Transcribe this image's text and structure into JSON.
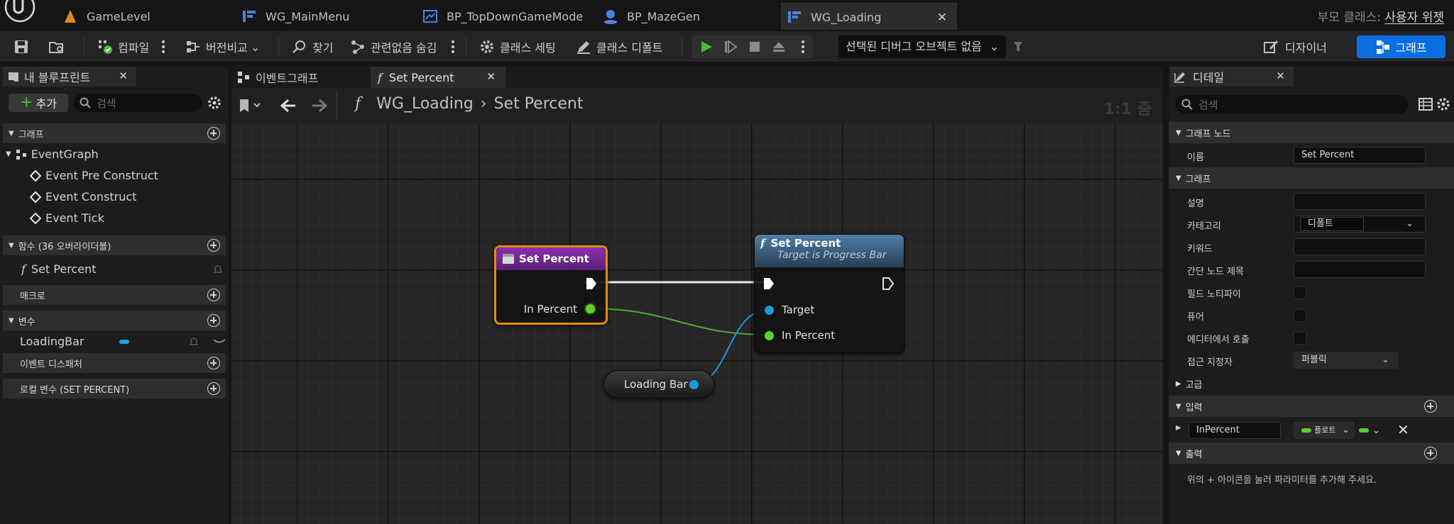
{
  "title_bar": {
    "tabs": [
      {
        "label": "GameLevel",
        "icon": "level-icon"
      },
      {
        "label": "WG_MainMenu",
        "icon": "widget-blueprint-icon"
      },
      {
        "label": "BP_TopDownGameMode",
        "icon": "blueprint-icon"
      },
      {
        "label": "BP_MazeGen",
        "icon": "actor-blueprint-icon"
      },
      {
        "label": "WG_Loading",
        "icon": "widget-blueprint-icon",
        "active": true
      }
    ],
    "parent_class_label": "부모 클래스:",
    "parent_class_value": "사용자 위젯"
  },
  "toolbar": {
    "compile": "컴파일",
    "diff": "버전비교",
    "find": "찾기",
    "hide_unrelated": "관련없음 숨김",
    "class_settings": "클래스 세팅",
    "class_defaults": "클래스 디폴트",
    "debug_object": "선택된 디버그 오브젝트 없음",
    "designer": "디자이너",
    "graph": "그래프"
  },
  "my_blueprint": {
    "tab_title": "내 블루프린트",
    "add_label": "추가",
    "search_placeholder": "검색",
    "sections": {
      "graph": "그래프",
      "functions": "함수 (36 오버라이더블)",
      "macros": "매크로",
      "variables": "변수",
      "event_dispatchers": "이벤트 디스패처",
      "local_variables": "로컬 변수 (SET PERCENT)"
    },
    "event_graph": "EventGraph",
    "events": [
      "Event Pre Construct",
      "Event Construct",
      "Event Tick"
    ],
    "functions": [
      "Set Percent"
    ],
    "variables": [
      {
        "name": "LoadingBar",
        "type_color": "#1ba6e6"
      }
    ]
  },
  "graph_editor": {
    "tabs": [
      "이벤트그래프",
      "Set Percent"
    ],
    "breadcrumb": [
      "WG_Loading",
      "Set Percent"
    ],
    "zoom": "1:1 줌",
    "entry_node": {
      "title": "Set Percent",
      "pin": "In Percent",
      "color": "#7a2a9a"
    },
    "call_node": {
      "title": "Set Percent",
      "subtitle": "Target is Progress Bar",
      "pins": [
        "Target",
        "In Percent"
      ],
      "color": "#3a5a7a"
    },
    "variable_node": {
      "label": "Loading Bar"
    }
  },
  "details": {
    "tab_title": "디테일",
    "search_placeholder": "검색",
    "sections": {
      "graph_node": "그래프 노드",
      "graph": "그래프",
      "advanced": "고급",
      "inputs": "입력",
      "outputs": "출력"
    },
    "rows": {
      "name_label": "이름",
      "name_value": "Set Percent",
      "description": "설명",
      "category": "카테고리",
      "category_value": "디폴트",
      "keywords": "키워드",
      "compact_title": "간단 노드 제목",
      "field_notify": "필드 노티파이",
      "pure": "퓨어",
      "call_in_editor": "에디터에서 호출",
      "access_specifier": "접근 지정자",
      "access_value": "퍼블릭"
    },
    "input_param": {
      "name": "InPercent",
      "type": "플로트",
      "type_color": "#5ccf2e"
    },
    "outputs_hint": "위의 + 아이콘을 눌러 파라미터를 추가해 주세요."
  }
}
